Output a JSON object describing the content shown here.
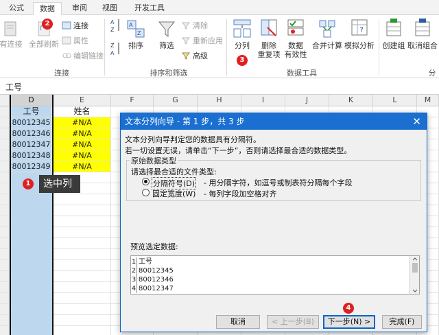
{
  "tabs": [
    "公式",
    "数据",
    "审阅",
    "视图",
    "开发工具"
  ],
  "active_tab": "数据",
  "ribbon": {
    "existing_connections": "有连接",
    "refresh_all": "全部刷新",
    "connections": "连接",
    "properties": "属性",
    "edit_links": "编辑链接",
    "group_connections": "连接",
    "sort": "排序",
    "filter": "筛选",
    "clear": "清除",
    "reapply": "重新应用",
    "advanced": "高级",
    "group_sort_filter": "排序和筛选",
    "text_to_columns": "分列",
    "remove_duplicates_1": "删除",
    "remove_duplicates_2": "重复项",
    "data_validation_1": "数据",
    "data_validation_2": "有效性",
    "consolidate": "合并计算",
    "what_if": "模拟分析",
    "group_data_tools": "数据工具",
    "group": "创建组",
    "ungroup": "取消组合",
    "group_outline": "分"
  },
  "name_box": "工号",
  "columns": [
    "D",
    "E",
    "F",
    "G",
    "H",
    "I",
    "J",
    "K",
    "L",
    "M"
  ],
  "sheet": {
    "header_d": "工号",
    "header_e": "姓名",
    "ids": [
      "80012345",
      "80012346",
      "80012347",
      "80012348",
      "80012349"
    ],
    "names": [
      "#N/A",
      "#N/A",
      "#N/A",
      "#N/A",
      "#N/A"
    ]
  },
  "annotations": {
    "step1": "1",
    "step1_label": "选中列",
    "step2": "2",
    "step3": "3",
    "step4": "4"
  },
  "dialog": {
    "title": "文本分列向导 - 第 1 步，共 3 步",
    "line1": "文本分列向导判定您的数据具有分隔符。",
    "line2": "若一切设置无误，请单击“下一步”，否则请选择最合适的数据类型。",
    "original_type": "原始数据类型",
    "choose_type": "请选择最合适的文件类型:",
    "opt_delimited": "分隔符号(D)",
    "opt_delimited_desc": "- 用分隔字符，如逗号或制表符分隔每个字段",
    "opt_fixed": "固定宽度(W)",
    "opt_fixed_desc": "- 每列字段加空格对齐",
    "preview_label": "预览选定数据:",
    "preview_rows": [
      {
        "n": "1",
        "v": "工号"
      },
      {
        "n": "2",
        "v": "80012345"
      },
      {
        "n": "3",
        "v": "80012346"
      },
      {
        "n": "4",
        "v": "80012347"
      }
    ],
    "cancel": "取消",
    "back": "< 上一步(B)",
    "next": "下一步(N) >",
    "finish": "完成(F)",
    "colors": {
      "title_bar": "#1a6fd0",
      "highlight": "#ffff00",
      "selection": "#bcd7ee"
    }
  }
}
